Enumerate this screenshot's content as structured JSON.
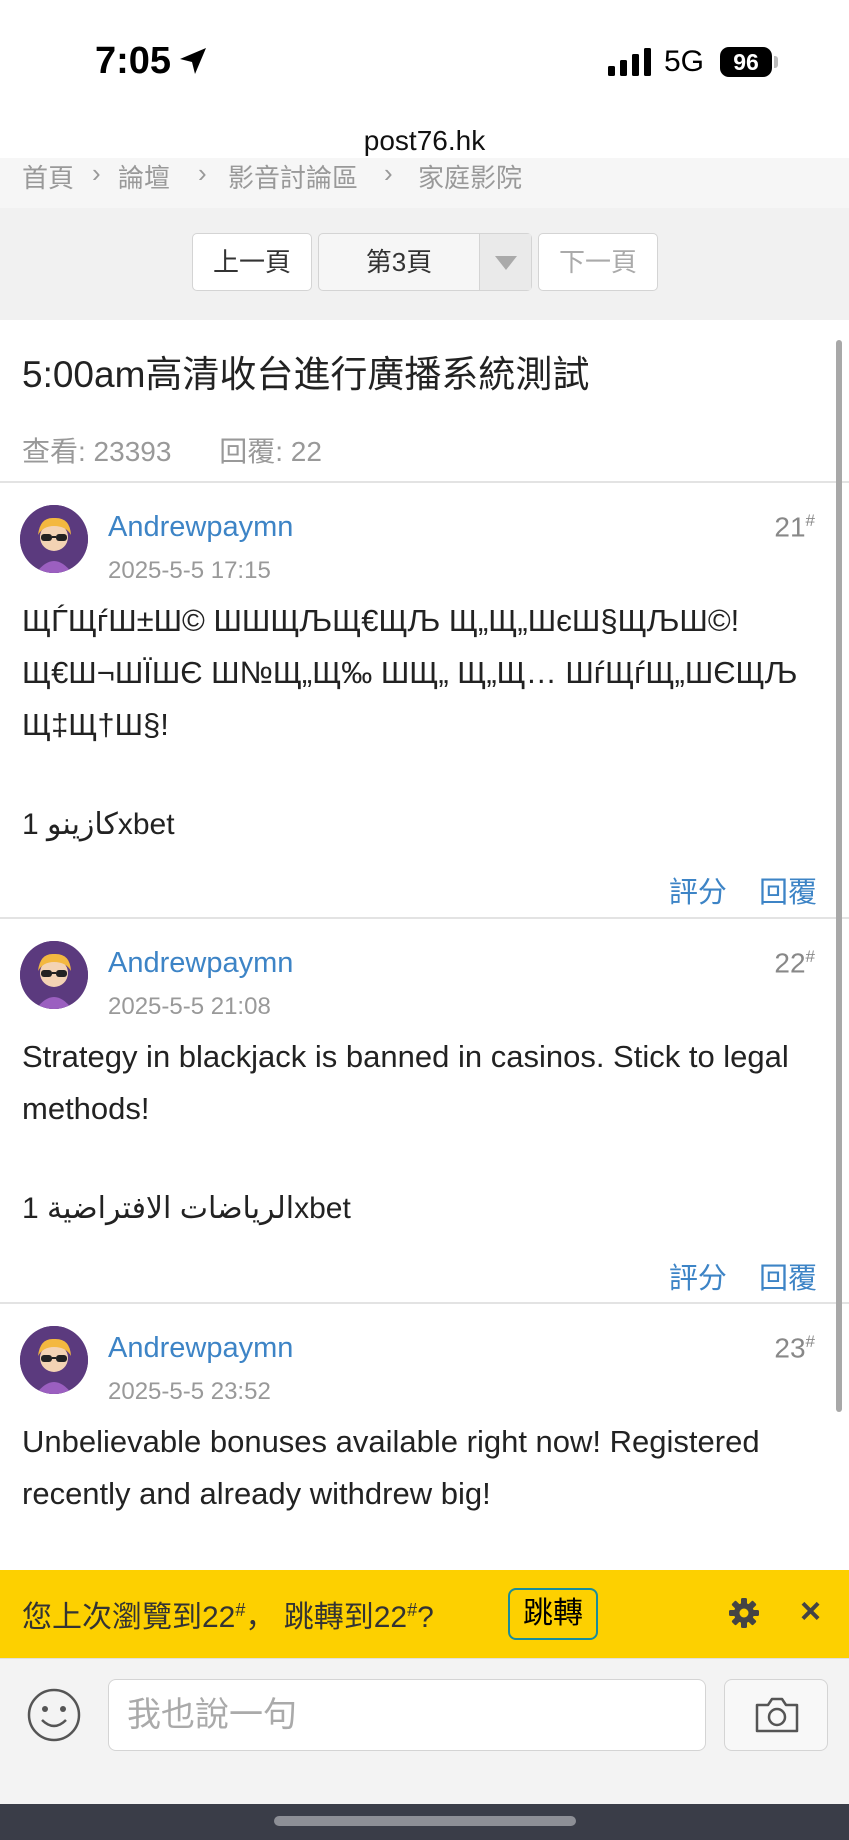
{
  "status_bar": {
    "time": "7:05",
    "network": "5G",
    "battery": "96"
  },
  "browser": {
    "url": "post76.hk"
  },
  "breadcrumb": {
    "items": [
      "首頁",
      "論壇",
      "影音討論區",
      "家庭影院"
    ]
  },
  "pager": {
    "prev_label": "上一頁",
    "current_page": "第3頁",
    "next_label": "下一頁"
  },
  "thread": {
    "title": "5:00am高清收台進行廣播系統測試",
    "views_label": "查看: 23393",
    "replies_label": "回覆: 22"
  },
  "posts": [
    {
      "author": "Andrewpaymn",
      "date": "2025-5-5 17:15",
      "floor": "21",
      "floor_mark": "#",
      "body": "ЩЃЩѓШ±Ш© ШШЩЉЩ€ЩЉ Щ„Щ„ШєШ§ЩЉШ©! Щ€Ш¬ШЇШЄ Ш№Щ„Щ‰ ШЩ„ Щ„Щ… ШѓЩѓЩ„ШЄЩЉ Щ‡Щ†Ш§!",
      "signature": "1 كازينوxbet",
      "rate_label": "評分",
      "reply_label": "回覆"
    },
    {
      "author": "Andrewpaymn",
      "date": "2025-5-5 21:08",
      "floor": "22",
      "floor_mark": "#",
      "body": "Strategy in blackjack is banned in casinos. Stick to legal methods!",
      "signature": "1 الرياضات الافتراضيةxbet",
      "rate_label": "評分",
      "reply_label": "回覆"
    },
    {
      "author": "Andrewpaymn",
      "date": "2025-5-5 23:52",
      "floor": "23",
      "floor_mark": "#",
      "body": "Unbelievable bonuses available right now! Registered recently and already withdrew big!"
    }
  ],
  "resume_bar": {
    "text_a": "您上次瀏覽到22",
    "mark": "#",
    "text_b": "， 跳轉到22",
    "text_c": "?",
    "jump_label": "跳轉",
    "close_label": "×"
  },
  "compose": {
    "placeholder": "我也說一句"
  },
  "colors": {
    "link_blue": "#3d84c6",
    "resume_yellow": "#fdd000",
    "muted_gray": "#999999"
  },
  "icons": [
    "location-arrow-icon",
    "cell-signal-icon",
    "dropdown-triangle-icon",
    "avatar-icon",
    "gear-icon",
    "close-icon",
    "smiley-icon",
    "camera-icon"
  ]
}
